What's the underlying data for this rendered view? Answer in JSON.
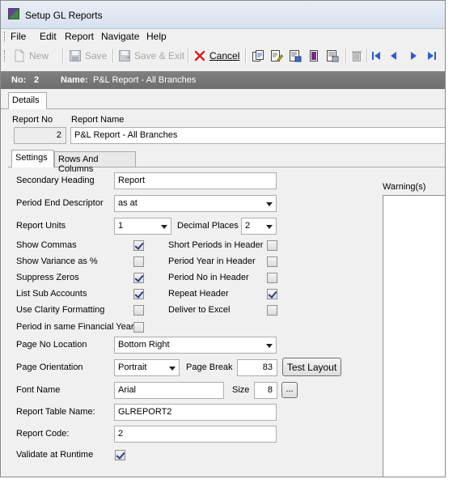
{
  "window": {
    "title": "Setup GL Reports"
  },
  "menu": {
    "items": [
      "File",
      "Edit",
      "Report",
      "Navigate",
      "Help"
    ]
  },
  "toolbar": {
    "new_label": "New",
    "save_label": "Save",
    "save_exit_label": "Save & Exit",
    "cancel_label": "Cancel",
    "new_icon": "new-document-icon",
    "save_icon": "floppy-disk-icon",
    "save_exit_icon": "floppy-exit-icon",
    "cancel_icon": "red-x-icon",
    "tool_icons": [
      "copy-report-icon",
      "edit-report-icon",
      "preview-report-icon",
      "print-report-icon",
      "report-layout-icon",
      "delete-icon",
      "first-record-icon",
      "previous-record-icon",
      "next-record-icon",
      "last-record-icon"
    ]
  },
  "infobar": {
    "no_label": "No:",
    "no_value": "2",
    "name_label": "Name:",
    "name_value": "P&L Report - All Branches"
  },
  "tabs": {
    "details": "Details"
  },
  "report": {
    "no_label": "Report No",
    "no_value": "2",
    "name_label": "Report Name",
    "name_value": "P&L Report - All Branches"
  },
  "subtabs": {
    "settings": "Settings",
    "rows_cols": "Rows And Columns"
  },
  "settings": {
    "secondary_heading_label": "Secondary Heading",
    "secondary_heading_value": "Report",
    "period_end_label": "Period End Descriptor",
    "period_end_value": "as at",
    "report_units_label": "Report Units",
    "report_units_value": "1",
    "decimal_places_label": "Decimal Places",
    "decimal_places_value": "2",
    "left_checks": [
      {
        "label": "Show Commas",
        "checked": true
      },
      {
        "label": "Show Variance as %",
        "checked": false
      },
      {
        "label": "Suppress Zeros",
        "checked": true
      },
      {
        "label": "List Sub Accounts",
        "checked": true
      },
      {
        "label": "Use Clarity Formatting",
        "checked": false
      }
    ],
    "right_checks": [
      {
        "label": "Short Periods in Header",
        "checked": false
      },
      {
        "label": "Period Year in Header",
        "checked": false
      },
      {
        "label": "Period No in Header",
        "checked": false
      },
      {
        "label": "Repeat Header",
        "checked": true
      },
      {
        "label": "Deliver to Excel",
        "checked": false
      }
    ],
    "same_fy_label": "Period in same Financial Year",
    "same_fy_checked": false,
    "page_no_location_label": "Page No Location",
    "page_no_location_value": "Bottom Right",
    "page_orientation_label": "Page Orientation",
    "page_orientation_value": "Portrait",
    "page_break_label": "Page Break",
    "page_break_value": "83",
    "test_layout_label": "Test Layout",
    "font_name_label": "Font Name",
    "font_name_value": "Arial",
    "size_label": "Size",
    "size_value": "8",
    "font_button_label": "...",
    "table_name_label": "Report Table Name:",
    "table_name_value": "GLREPORT2",
    "report_code_label": "Report Code:",
    "report_code_value": "2",
    "validate_label": "Validate at Runtime",
    "validate_checked": true
  },
  "warnings": {
    "label": "Warning(s)"
  },
  "colors": {
    "infobar": "#777777",
    "cancel_x": "#d42020",
    "nav_arrows": "#2b5fd0"
  }
}
